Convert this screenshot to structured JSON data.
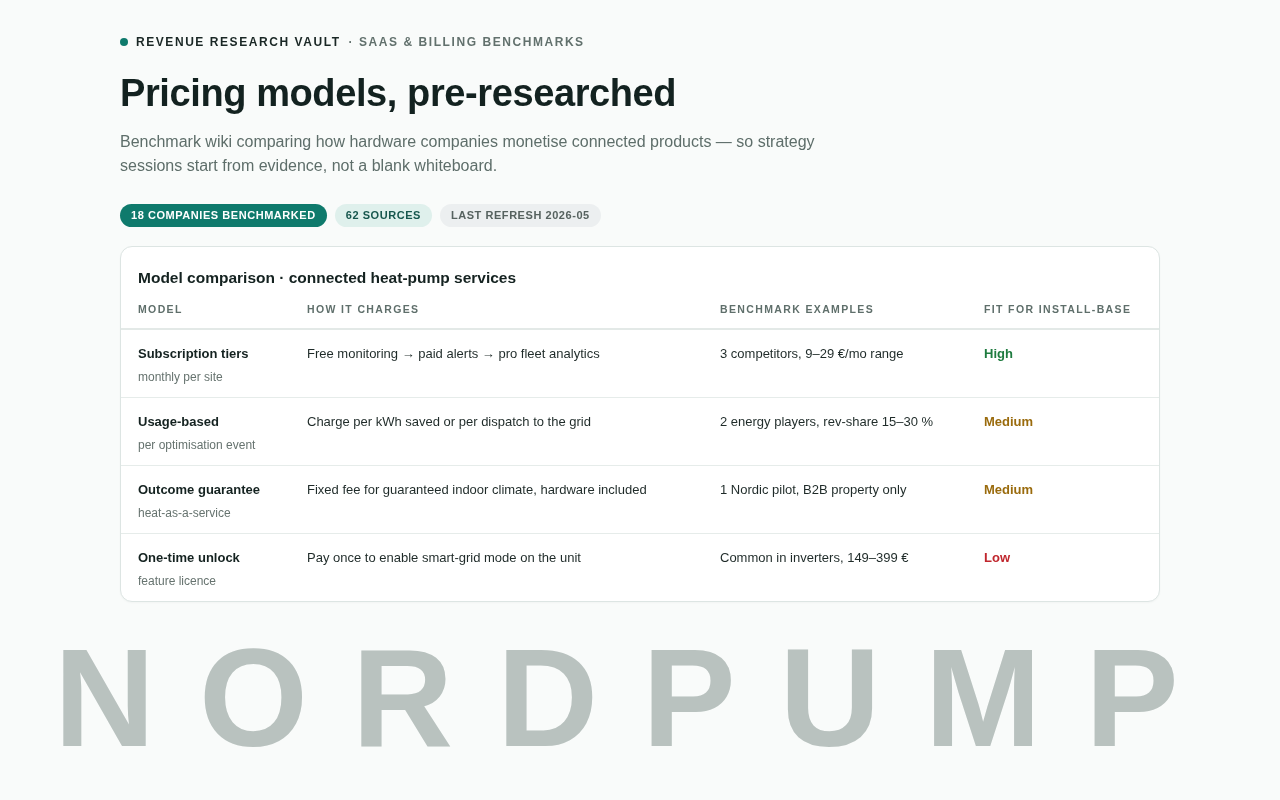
{
  "backdrop_text": "NORDPUMP",
  "eyebrow": {
    "brand": "REVENUE RESEARCH VAULT",
    "section": "· SAAS & BILLING BENCHMARKS"
  },
  "title": "Pricing models, pre-researched",
  "subtitle": "Benchmark wiki comparing how hardware companies monetise connected products — so strategy sessions start from evidence, not a blank whiteboard.",
  "badges": [
    {
      "text": "18 COMPANIES BENCHMARKED",
      "kind": "primary"
    },
    {
      "text": "62 SOURCES",
      "kind": "soft"
    },
    {
      "text": "LAST REFRESH 2026-05",
      "kind": "muted"
    }
  ],
  "table": {
    "title": "Model comparison · connected heat-pump services",
    "columns": [
      "MODEL",
      "HOW IT CHARGES",
      "BENCHMARK EXAMPLES",
      "FIT FOR INSTALL-BASE"
    ],
    "rows": [
      {
        "model": "Subscription tiers",
        "note": "monthly per site",
        "charges": "Free monitoring → paid alerts → pro fleet analytics",
        "examples": "3 competitors, 9–29 €/mo range",
        "fit": {
          "text": "High",
          "color": "#1e7b3f"
        }
      },
      {
        "model": "Usage-based",
        "note": "per optimisation event",
        "charges": "Charge per kWh saved or per dispatch to the grid",
        "examples": "2 energy players, rev-share 15–30 %",
        "fit": {
          "text": "Medium",
          "color": "#9a6b0d"
        }
      },
      {
        "model": "Outcome guarantee",
        "note": "heat-as-a-service",
        "charges": "Fixed fee for guaranteed indoor climate, hardware included",
        "examples": "1 Nordic pilot, B2B property only",
        "fit": {
          "text": "Medium",
          "color": "#9a6b0d"
        }
      },
      {
        "model": "One-time unlock",
        "note": "feature licence",
        "charges": "Pay once to enable smart-grid mode on the unit",
        "examples": "Common in inverters, 149–399 €",
        "fit": {
          "text": "Low",
          "color": "#c0262d"
        }
      }
    ]
  }
}
